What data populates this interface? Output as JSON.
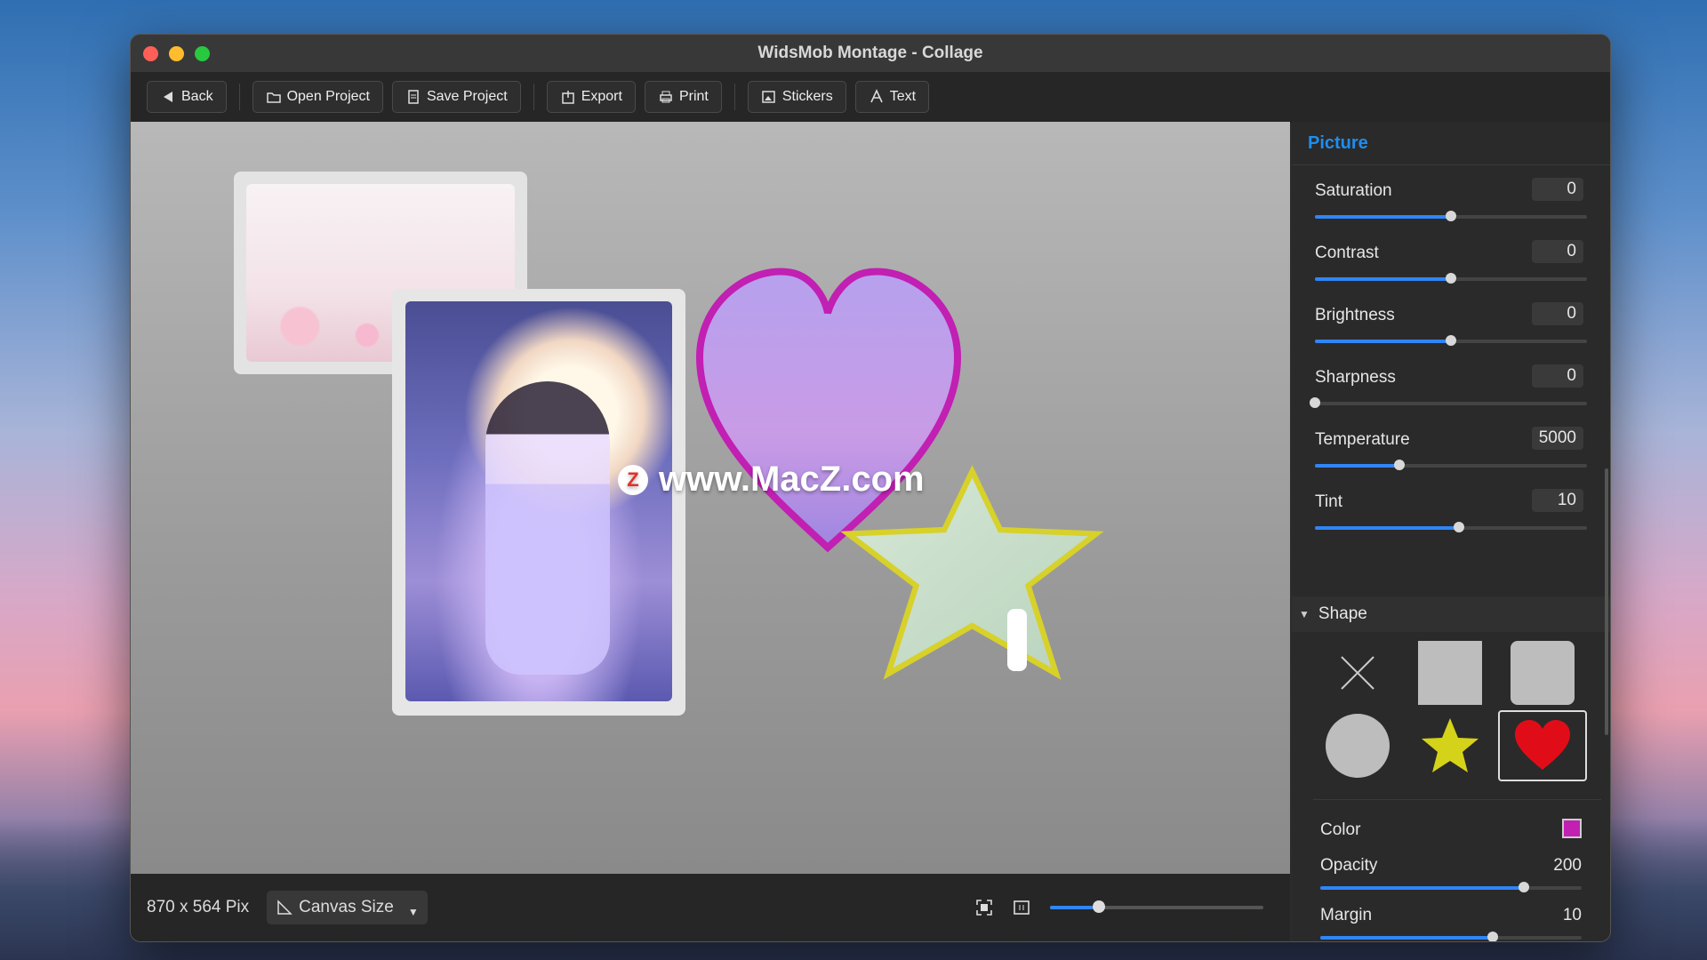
{
  "window": {
    "title": "WidsMob Montage - Collage"
  },
  "toolbar": {
    "back": "Back",
    "open_project": "Open Project",
    "save_project": "Save Project",
    "export": "Export",
    "print": "Print",
    "stickers": "Stickers",
    "text": "Text"
  },
  "canvas": {
    "watermark_text": "www.MacZ.com",
    "watermark_logo": "Z"
  },
  "statusbar": {
    "dimensions": "870 x 564 Pix",
    "canvas_size_label": "Canvas Size",
    "zoom_fraction": 0.2
  },
  "panel": {
    "title": "Picture",
    "adjustments": [
      {
        "label": "Saturation",
        "value": "0",
        "fraction": 0.5
      },
      {
        "label": "Contrast",
        "value": "0",
        "fraction": 0.5
      },
      {
        "label": "Brightness",
        "value": "0",
        "fraction": 0.5
      },
      {
        "label": "Sharpness",
        "value": "0",
        "fraction": 0.0
      },
      {
        "label": "Temperature",
        "value": "5000",
        "fraction": 0.31
      },
      {
        "label": "Tint",
        "value": "10",
        "fraction": 0.53
      }
    ],
    "shape_section": "Shape",
    "shapes": [
      "none-icon",
      "square-icon",
      "rounded-square-icon",
      "circle-icon",
      "star-icon",
      "heart-icon"
    ],
    "selected_shape": "heart-icon",
    "color_label": "Color",
    "color_value": "#c21fb3",
    "opacity_label": "Opacity",
    "opacity_value": "200",
    "opacity_fraction": 0.78,
    "margin_label": "Margin",
    "margin_value": "10",
    "margin_fraction": 0.66
  },
  "colors": {
    "accent": "#2f86f6",
    "heart_border": "#c21fb3",
    "star_border": "#d7d12a"
  }
}
